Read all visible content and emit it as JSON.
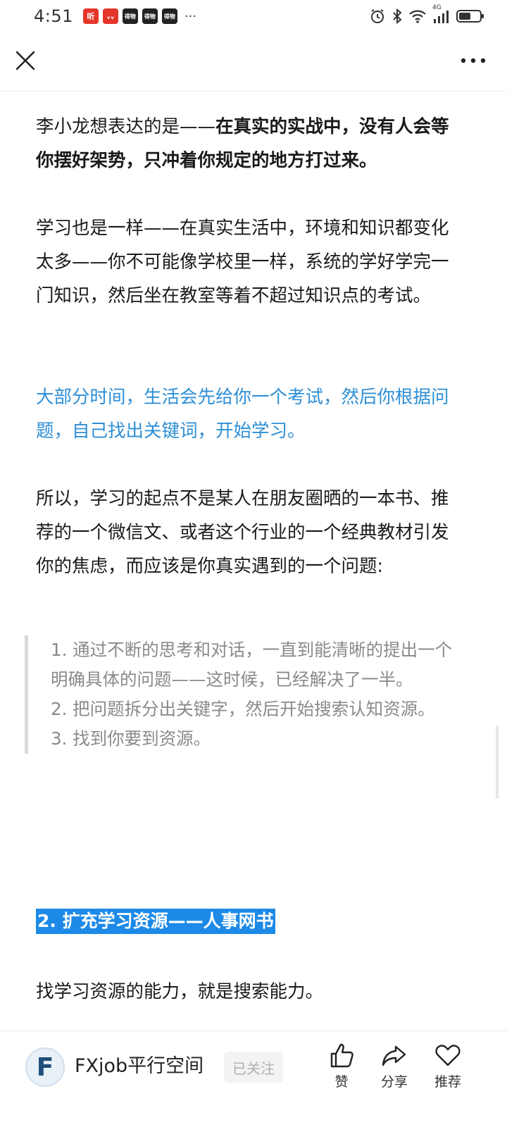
{
  "status_bar": {
    "time": "4:51",
    "app_icons": [
      {
        "name": "ting-app-icon",
        "label": "听",
        "style": "red"
      },
      {
        "name": "stock-app-icon",
        "label": "ᵥᵥ",
        "style": "red"
      },
      {
        "name": "dewu-app-icon",
        "label": "得物",
        "style": "dark"
      },
      {
        "name": "dewu-app-icon",
        "label": "得物",
        "style": "dark"
      },
      {
        "name": "dewu-app-icon",
        "label": "得物",
        "style": "dark"
      }
    ],
    "more": "···",
    "network": "4G"
  },
  "top_bar": {
    "close_icon": "close-icon",
    "more_icon": "more-icon"
  },
  "article": {
    "p1_normal": "李小龙想表达的是——",
    "p1_bold": "在真实的实战中，没有人会等你摆好架势，只冲着你规定的地方打过来。",
    "p2": "学习也是一样——在真实生活中，环境和知识都变化太多——你不可能像学校里一样，系统的学好学完一门知识，然后坐在教室等着不超过知识点的考试。",
    "p3": "大部分时间，生活会先给你一个考试，然后你根据问题，自己找出关键词，开始学习。",
    "p4": "所以，学习的起点不是某人在朋友圈晒的一本书、推荐的一个微信文、或者这个行业的一个经典教材引发你的焦虑，而应该是你真实遇到的一个问题:",
    "quote_items": [
      "1. 通过不断的思考和对话，一直到能清晰的提出一个明确具体的问题——这时候，已经解决了一半。",
      "2. 把问题拆分出关键字，然后开始搜索认知资源。",
      "3.  找到你要到资源。"
    ],
    "heading": "2. 扩充学习资源——人事网书",
    "p5": "找学习资源的能力，就是搜索能力。",
    "colors": {
      "link_blue": "#2e8fd6",
      "heading_bg": "#1d8ae8",
      "quote_text": "#8a8a8a"
    }
  },
  "bottom_bar": {
    "avatar_letter": "F",
    "author_name": "FXjob平行空间",
    "follow_label": "已关注",
    "actions": [
      {
        "icon": "thumbs-up-icon",
        "label": "赞"
      },
      {
        "icon": "share-icon",
        "label": "分享"
      },
      {
        "icon": "heart-icon",
        "label": "推荐"
      }
    ]
  }
}
